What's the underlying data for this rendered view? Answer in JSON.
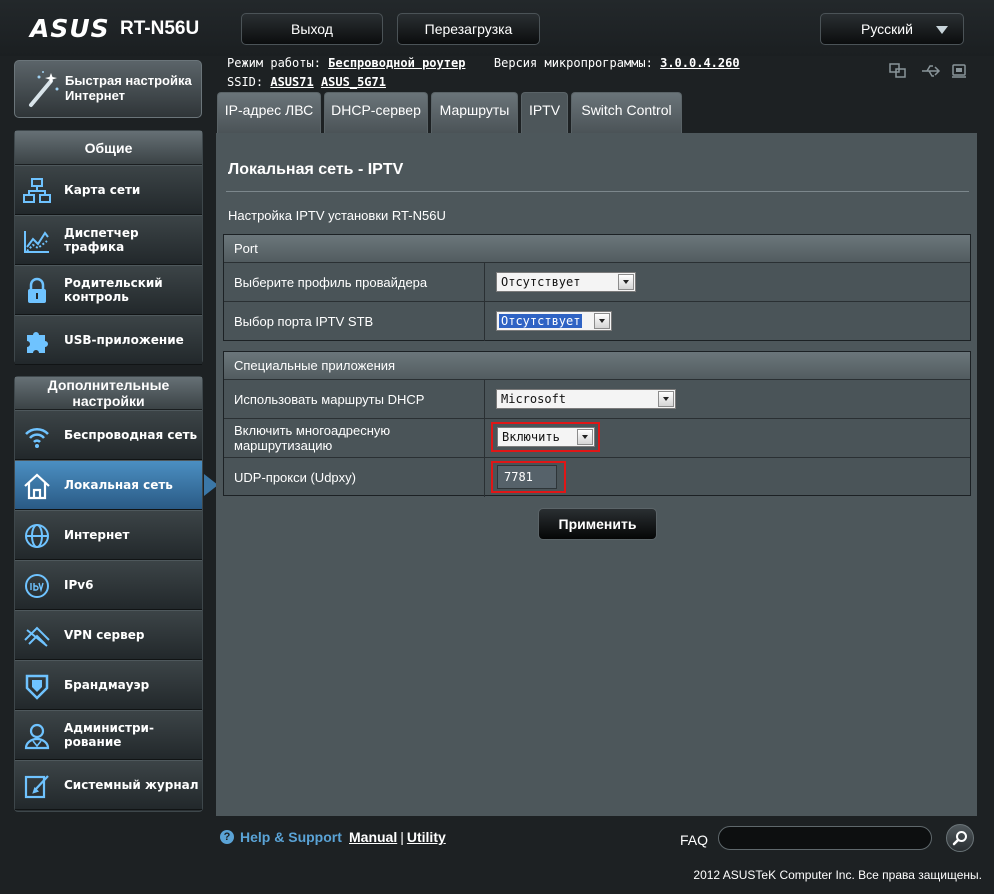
{
  "header": {
    "logo_brand": "ASUS",
    "model": "RT-N56U",
    "logout_label": "Выход",
    "reboot_label": "Перезагрузка",
    "language": "Русский"
  },
  "info": {
    "mode_label": "Режим работы:",
    "mode_value": "Беспроводной роутер",
    "firmware_label": "Версия микропрограммы:",
    "firmware_value": "3.0.0.4.260",
    "ssid_label": "SSID:",
    "ssid_1": "ASUS71",
    "ssid_2": "ASUS_5G71"
  },
  "sidebar": {
    "quick_setup": "Быстрая настройка Интернет",
    "general_title": "Общие",
    "general_items": [
      {
        "label": "Карта сети",
        "icon": "network-map-icon"
      },
      {
        "label": "Диспетчер трафика",
        "icon": "traffic-manager-icon"
      },
      {
        "label": "Родительский контроль",
        "icon": "lock-icon"
      },
      {
        "label": "USB-приложение",
        "icon": "puzzle-icon"
      }
    ],
    "advanced_title": "Дополнительные настройки",
    "advanced_items": [
      {
        "label": "Беспроводная сеть",
        "icon": "wireless-icon"
      },
      {
        "label": "Локальная сеть",
        "icon": "home-icon",
        "active": true
      },
      {
        "label": "Интернет",
        "icon": "globe-icon"
      },
      {
        "label": "IPv6",
        "icon": "ipv6-icon"
      },
      {
        "label": "VPN сервер",
        "icon": "vpn-icon"
      },
      {
        "label": "Брандмауэр",
        "icon": "shield-icon"
      },
      {
        "label": "Администри-рование",
        "icon": "admin-icon"
      },
      {
        "label": "Системный журнал",
        "icon": "log-icon"
      }
    ]
  },
  "tabs": [
    {
      "label": "IP-адрес ЛВС"
    },
    {
      "label": "DHCP-сервер"
    },
    {
      "label": "Маршруты"
    },
    {
      "label": "IPTV",
      "active": true
    },
    {
      "label": "Switch Control"
    }
  ],
  "main": {
    "title": "Локальная сеть - IPTV",
    "description": "Настройка IPTV установки RT-N56U",
    "port_section": {
      "title": "Port",
      "rows": [
        {
          "label": "Выберите профиль провайдера",
          "value": "Отсутствует"
        },
        {
          "label": "Выбор порта IPTV STB",
          "value": "Отсутствует"
        }
      ]
    },
    "apps_section": {
      "title": "Специальные приложения",
      "rows": [
        {
          "label": "Использовать маршруты DHCP",
          "value": "Microsoft"
        },
        {
          "label": "Включить многоадресную маршрутизацию",
          "value": "Включить"
        },
        {
          "label": "UDP-прокси (Udpxy)",
          "value": "7781"
        }
      ]
    },
    "apply_label": "Применить"
  },
  "footer": {
    "help": "Help & Support",
    "manual": "Manual",
    "separator": "|",
    "utility": "Utility",
    "faq_label": "FAQ",
    "copyright": "2012 ASUSTeK Computer Inc. Все права защищены."
  },
  "colors": {
    "accent_blue": "#4b8fc2",
    "highlight_red": "#e01616",
    "panel_bg": "#4d575b"
  }
}
